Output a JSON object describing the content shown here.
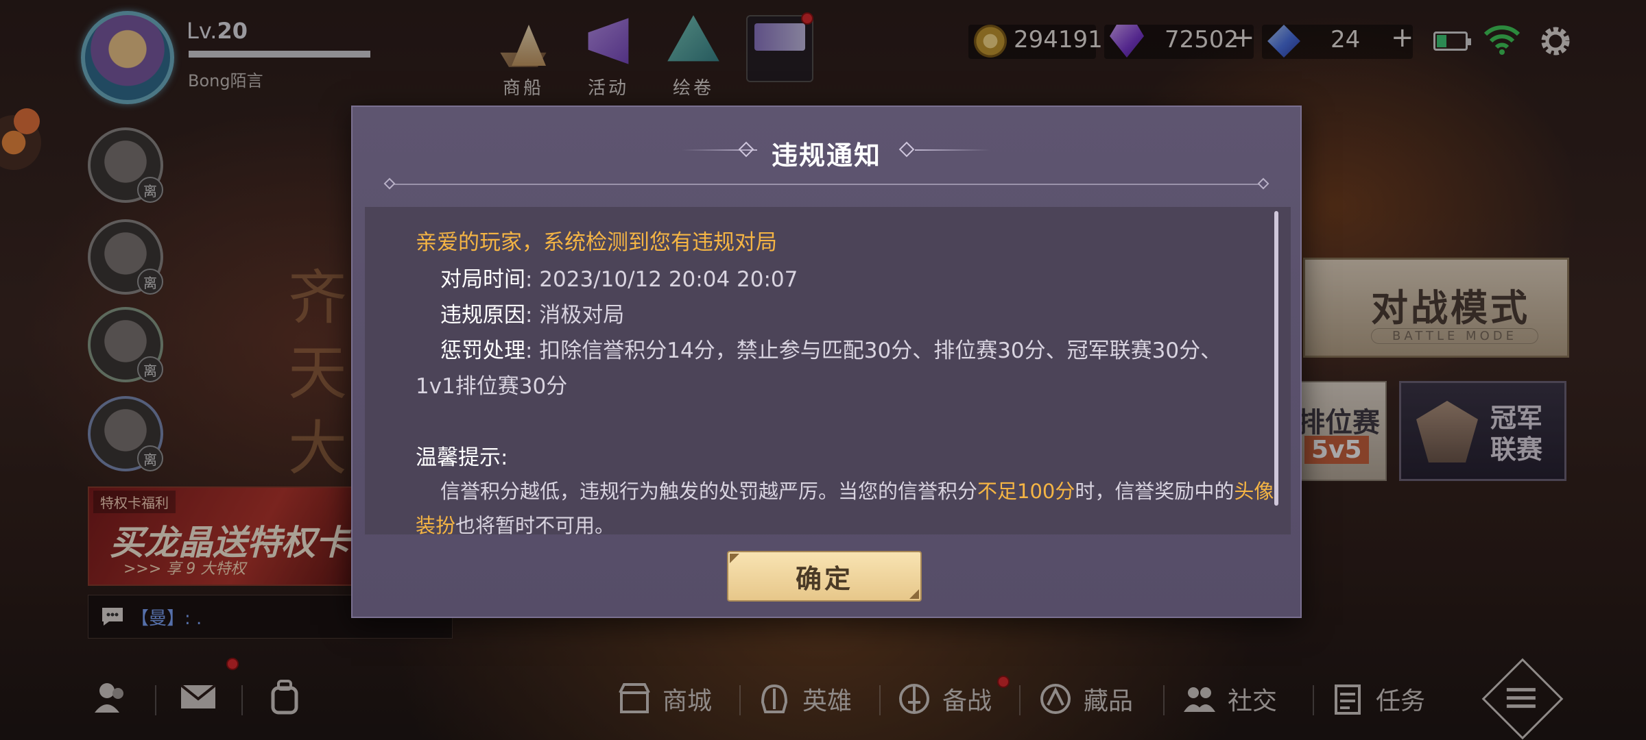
{
  "profile": {
    "level_prefix": "Lv.",
    "level": "20",
    "name": "Bong陌言",
    "xp_fraction": 1.0
  },
  "friends": {
    "away_label": "离"
  },
  "promo": {
    "tag": "特权卡福利",
    "main": "买龙晶送特权卡",
    "sub": ">>> 享 9 大特权"
  },
  "chat": {
    "text": "【曼】: ."
  },
  "top_nav": [
    {
      "label": "商船",
      "icon": "ship-icon"
    },
    {
      "label": "活动",
      "icon": "megaphone-icon"
    },
    {
      "label": "绘卷",
      "icon": "scroll-icon"
    }
  ],
  "currencies": {
    "gold": "294191",
    "gem": "72502",
    "crystal": "24",
    "plus": "+"
  },
  "battery_level": 0.35,
  "modes": {
    "battle_title": "对战模式",
    "battle_sub": "BATTLE MODE",
    "rank_title": "排位赛",
    "rank_sub": "5v5",
    "champ_title": "冠军\n联赛"
  },
  "background_text": "齐天大圣",
  "bottom_nav": [
    {
      "label": "商城",
      "icon": "shop-icon"
    },
    {
      "label": "英雄",
      "icon": "helmet-icon"
    },
    {
      "label": "备战",
      "icon": "sword-icon"
    },
    {
      "label": "藏品",
      "icon": "collection-icon"
    },
    {
      "label": "社交",
      "icon": "social-icon"
    },
    {
      "label": "任务",
      "icon": "task-icon"
    }
  ],
  "modal": {
    "title": "违规通知",
    "greeting": "亲爱的玩家，系统检测到您有违规对局",
    "time_label": "对局时间",
    "time_value": ": 2023/10/12 20:04 20:07",
    "reason_label": "违规原因",
    "reason_value": ": 消极对局",
    "penalty_label": "惩罚处理",
    "penalty_value": ": 扣除信誉积分14分，禁止参与匹配30分、排位赛30分、冠军联赛30分、",
    "penalty_value2": "1v1排位赛30分",
    "tip_title": "温馨提示:",
    "tip_part1": "信誉积分越低，违规行为触发的处罚越严厉。当您的信誉积分",
    "tip_highlight1": "不足100分",
    "tip_part2": "时，信誉奖励中的",
    "tip_highlight2a": "头像",
    "tip_highlight2b": "装扮",
    "tip_part3": "也将暂时不可用。",
    "ok_label": "确定"
  },
  "colors": {
    "accent_orange": "#f5b544",
    "modal_bg": "#564d68",
    "button_gold": "#e7c78a",
    "alert_red": "#e0282c"
  }
}
